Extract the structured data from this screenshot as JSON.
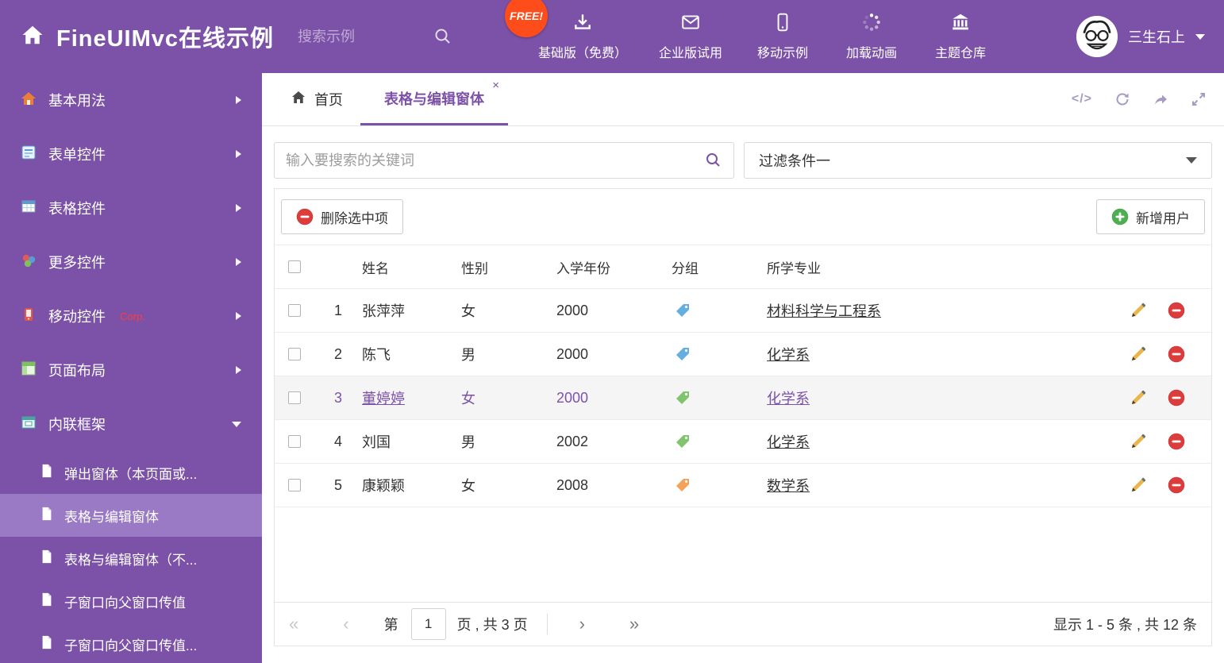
{
  "header": {
    "title": "FineUIMvc在线示例",
    "search_placeholder": "搜索示例",
    "free_badge": "FREE!",
    "nav": [
      {
        "label": "基础版（免费）",
        "icon": "download-icon"
      },
      {
        "label": "企业版试用",
        "icon": "envelope-icon"
      },
      {
        "label": "移动示例",
        "icon": "mobile-icon"
      },
      {
        "label": "加载动画",
        "icon": "spinner-icon"
      },
      {
        "label": "主题仓库",
        "icon": "bank-icon"
      }
    ],
    "user_name": "三生石上"
  },
  "sidebar": {
    "items": [
      {
        "label": "基本用法"
      },
      {
        "label": "表单控件"
      },
      {
        "label": "表格控件"
      },
      {
        "label": "更多控件"
      },
      {
        "label": "移动控件",
        "badge": "Corp."
      },
      {
        "label": "页面布局"
      },
      {
        "label": "内联框架",
        "expanded": true
      }
    ],
    "subitems": [
      {
        "label": "弹出窗体（本页面或..."
      },
      {
        "label": "表格与编辑窗体",
        "active": true
      },
      {
        "label": "表格与编辑窗体（不..."
      },
      {
        "label": "子窗口向父窗口传值"
      },
      {
        "label": "子窗口向父窗口传值..."
      }
    ]
  },
  "tabs": {
    "home_label": "首页",
    "active_label": "表格与编辑窗体",
    "close_glyph": "×",
    "tools": [
      "code",
      "refresh",
      "forward",
      "fullscreen"
    ]
  },
  "filter": {
    "search_placeholder": "输入要搜索的关键词",
    "selected_option": "过滤条件一"
  },
  "toolbar": {
    "delete_label": "删除选中项",
    "add_label": "新增用户"
  },
  "table": {
    "columns": {
      "name": "姓名",
      "gender": "性别",
      "year": "入学年份",
      "group": "分组",
      "major": "所学专业"
    },
    "rows": [
      {
        "num": "1",
        "name": "张萍萍",
        "gender": "女",
        "year": "2000",
        "tag_color": "#64aee0",
        "major": "材料科学与工程系"
      },
      {
        "num": "2",
        "name": "陈飞",
        "gender": "男",
        "year": "2000",
        "tag_color": "#64aee0",
        "major": "化学系"
      },
      {
        "num": "3",
        "name": "董婷婷",
        "gender": "女",
        "year": "2000",
        "tag_color": "#82c36e",
        "major": "化学系",
        "selected": true
      },
      {
        "num": "4",
        "name": "刘国",
        "gender": "男",
        "year": "2002",
        "tag_color": "#82c36e",
        "major": "化学系"
      },
      {
        "num": "5",
        "name": "康颖颖",
        "gender": "女",
        "year": "2008",
        "tag_color": "#f4a259",
        "major": "数学系"
      }
    ]
  },
  "pagination": {
    "first_glyph": "«",
    "prev_glyph": "‹",
    "next_glyph": "›",
    "last_glyph": "»",
    "prefix": "第",
    "current_page": "1",
    "suffix": "页 , 共 3 页",
    "summary": "显示 1 - 5 条 , 共 12 条"
  },
  "colors": {
    "primary_purple": "#7C52A8",
    "free_badge": "#ff4c1b",
    "delete_red": "#dd3c3c",
    "add_green": "#4caf50",
    "pencil_gold": "#e8b64c"
  }
}
